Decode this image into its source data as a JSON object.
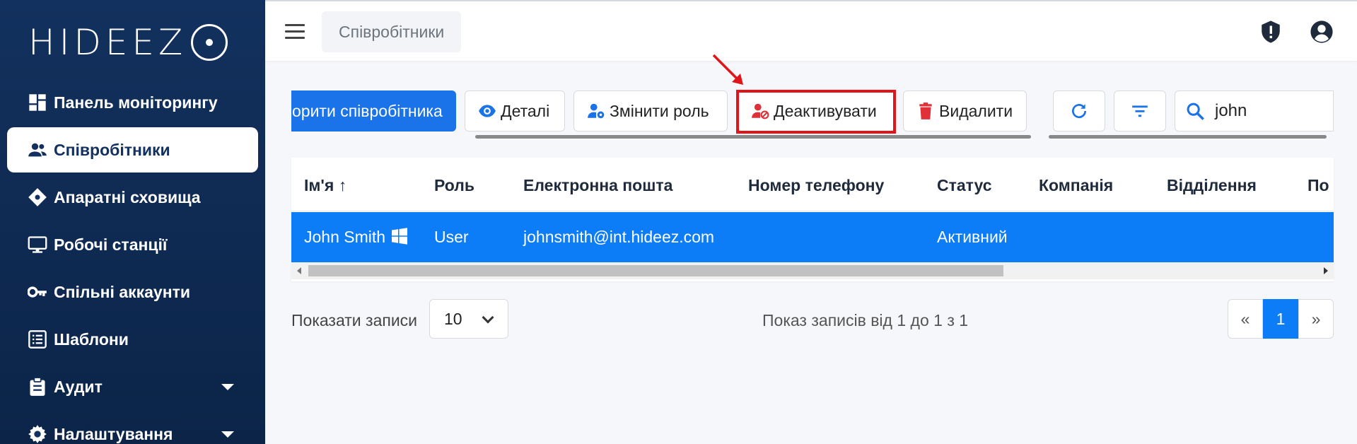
{
  "brand": {
    "logo_text": "HIDEEZ"
  },
  "sidebar": {
    "items": [
      {
        "label": "Панель моніторингу",
        "icon": "dashboard-icon"
      },
      {
        "label": "Співробітники",
        "icon": "users-icon",
        "active": true
      },
      {
        "label": "Апаратні сховища",
        "icon": "hardware-vault-icon"
      },
      {
        "label": "Робочі станції",
        "icon": "monitor-icon"
      },
      {
        "label": "Спільні аккаунти",
        "icon": "key-icon"
      },
      {
        "label": "Шаблони",
        "icon": "template-list-icon"
      },
      {
        "label": "Аудит",
        "icon": "clipboard-icon",
        "has_submenu": true
      },
      {
        "label": "Налаштування",
        "icon": "gear-icon",
        "has_submenu": true
      }
    ]
  },
  "header": {
    "breadcrumb": "Співробітники",
    "icons": [
      "shield-alert-icon",
      "user-circle-icon"
    ]
  },
  "toolbar": {
    "create_label": "орити співробітника",
    "details_label": "Деталі",
    "change_role_label": "Змінити роль",
    "deactivate_label": "Деактивувати",
    "delete_label": "Видалити",
    "refresh_icon": "refresh-icon",
    "filter_icon": "filter-icon",
    "search_value": "john"
  },
  "table": {
    "columns": [
      "Ім'я",
      "Роль",
      "Електронна пошта",
      "Номер телефону",
      "Статус",
      "Компанія",
      "Відділення",
      "По"
    ],
    "sort_indicator": "↑",
    "rows": [
      {
        "name": "John Smith",
        "os_icon": "windows-icon",
        "role": "User",
        "email": "johnsmith@int.hideez.com",
        "phone": "",
        "status": "Активний",
        "company": "",
        "department": ""
      }
    ]
  },
  "footer": {
    "show_label": "Показати записи",
    "page_size": "10",
    "info": "Показ записів від 1 до 1 з 1",
    "pager": {
      "prev": "«",
      "current": "1",
      "next": "»"
    }
  },
  "colors": {
    "sidebar_bg": "#13315e",
    "primary": "#1a73e8",
    "selected_row": "#0d7cf7",
    "highlight_border": "#e0151a",
    "danger": "#e0313a"
  }
}
